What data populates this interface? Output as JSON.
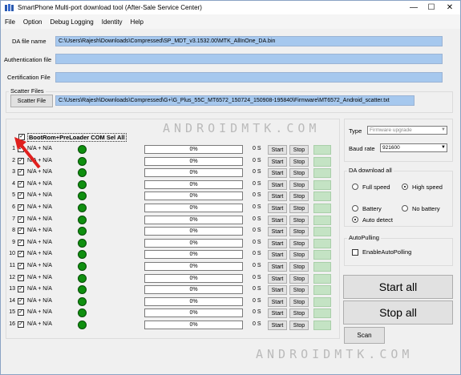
{
  "window": {
    "title": "SmartPhone Multi-port download tool (After-Sale Service Center)",
    "controls": [
      "—",
      "☐",
      "✕"
    ]
  },
  "menu": [
    "File",
    "Option",
    "Debug Logging",
    "Identity",
    "Help"
  ],
  "fields": {
    "da_label": "DA file name",
    "da_value": "C:\\Users\\Rajesh\\Downloads\\Compressed\\SP_MDT_v3.1532.00\\MTK_AllInOne_DA.bin",
    "auth_label": "Authentication file",
    "auth_value": "",
    "cert_label": "Certification File",
    "cert_value": "",
    "scatter_group": "Scatter Files",
    "scatter_button": "Scatter File",
    "scatter_value": "C:\\Users\\Rajesh\\Downloads\\Compressed\\G+\\G_Plus_55C_MT6572_150724_150908-195840\\Firmware\\MT6572_Android_scatter.txt"
  },
  "ports": {
    "header": "BootRom+PreLoader COM Sel All",
    "header_checked": true,
    "rows": [
      {
        "num": "1",
        "port": "N/A + N/A",
        "progress": "0%",
        "time": "0 S",
        "start": "Start",
        "stop": "Stop"
      },
      {
        "num": "2",
        "port": "N/A + N/A",
        "progress": "0%",
        "time": "0 S",
        "start": "Start",
        "stop": "Stop"
      },
      {
        "num": "3",
        "port": "N/A + N/A",
        "progress": "0%",
        "time": "0 S",
        "start": "Start",
        "stop": "Stop"
      },
      {
        "num": "4",
        "port": "N/A + N/A",
        "progress": "0%",
        "time": "0 S",
        "start": "Start",
        "stop": "Stop"
      },
      {
        "num": "5",
        "port": "N/A + N/A",
        "progress": "0%",
        "time": "0 S",
        "start": "Start",
        "stop": "Stop"
      },
      {
        "num": "6",
        "port": "N/A + N/A",
        "progress": "0%",
        "time": "0 S",
        "start": "Start",
        "stop": "Stop"
      },
      {
        "num": "7",
        "port": "N/A + N/A",
        "progress": "0%",
        "time": "0 S",
        "start": "Start",
        "stop": "Stop"
      },
      {
        "num": "8",
        "port": "N/A + N/A",
        "progress": "0%",
        "time": "0 S",
        "start": "Start",
        "stop": "Stop"
      },
      {
        "num": "9",
        "port": "N/A + N/A",
        "progress": "0%",
        "time": "0 S",
        "start": "Start",
        "stop": "Stop"
      },
      {
        "num": "10",
        "port": "N/A + N/A",
        "progress": "0%",
        "time": "0 S",
        "start": "Start",
        "stop": "Stop"
      },
      {
        "num": "11",
        "port": "N/A + N/A",
        "progress": "0%",
        "time": "0 S",
        "start": "Start",
        "stop": "Stop"
      },
      {
        "num": "12",
        "port": "N/A + N/A",
        "progress": "0%",
        "time": "0 S",
        "start": "Start",
        "stop": "Stop"
      },
      {
        "num": "13",
        "port": "N/A + N/A",
        "progress": "0%",
        "time": "0 S",
        "start": "Start",
        "stop": "Stop"
      },
      {
        "num": "14",
        "port": "N/A + N/A",
        "progress": "0%",
        "time": "0 S",
        "start": "Start",
        "stop": "Stop"
      },
      {
        "num": "15",
        "port": "N/A + N/A",
        "progress": "0%",
        "time": "0 S",
        "start": "Start",
        "stop": "Stop"
      },
      {
        "num": "16",
        "port": "N/A + N/A",
        "progress": "0%",
        "time": "0 S",
        "start": "Start",
        "stop": "Stop"
      }
    ]
  },
  "settings": {
    "type_label": "Type",
    "type_value": "Firmware upgrade",
    "baud_label": "Baud rate",
    "baud_value": "921600",
    "da_download_group": "DA download all",
    "full_speed": "Full speed",
    "high_speed": "High speed",
    "battery": "Battery",
    "no_battery": "No battery",
    "auto_detect": "Auto detect",
    "autopulling_group": "AutoPulling",
    "enable_autopulling": "EnableAutoPolling",
    "start_all": "Start all",
    "stop_all": "Stop all",
    "scan": "Scan"
  },
  "watermark": "ANDROIDMTK.COM",
  "colors": {
    "field_bg": "#a6c8ee",
    "led_green": "#0f8f0f",
    "status_box": "#c4e3c4",
    "arrow_red": "#e0201e"
  }
}
